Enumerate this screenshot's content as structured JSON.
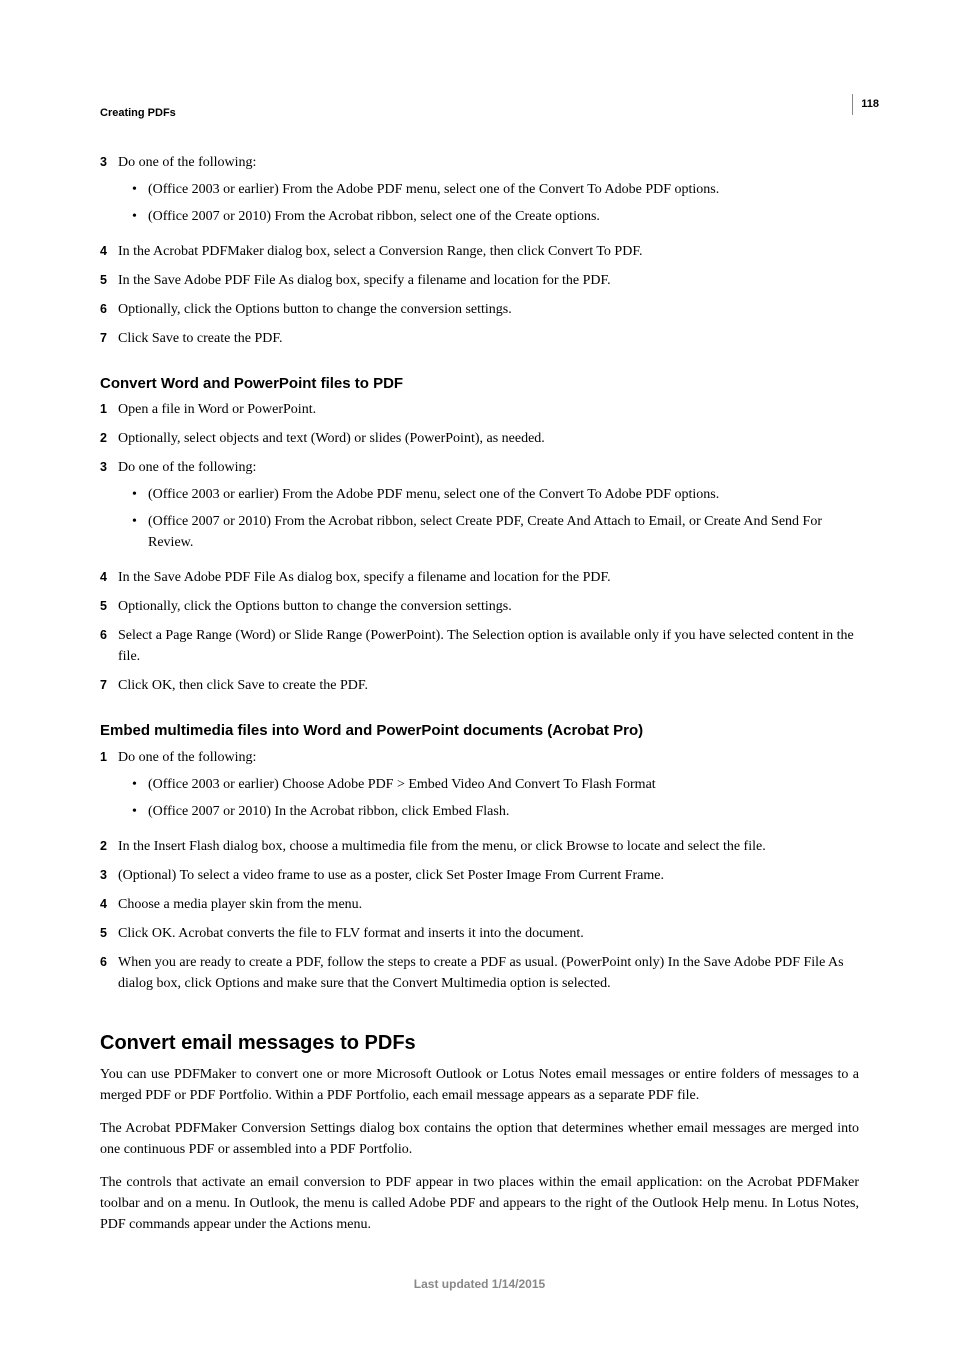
{
  "page_number": "118",
  "header": "Creating PDFs",
  "s1": {
    "i3": {
      "n": "3",
      "t": "Do one of the following:"
    },
    "i3a": "(Office 2003 or earlier) From the Adobe PDF menu, select one of the Convert To Adobe PDF options.",
    "i3b": "(Office 2007 or 2010) From the Acrobat ribbon, select one of the Create options.",
    "i4": {
      "n": "4",
      "t": "In the Acrobat PDFMaker dialog box, select a Conversion Range, then click Convert To PDF."
    },
    "i5": {
      "n": "5",
      "t": "In the Save Adobe PDF File As dialog box, specify a filename and location for the PDF."
    },
    "i6": {
      "n": "6",
      "t": "Optionally, click the Options button to change the conversion settings."
    },
    "i7": {
      "n": "7",
      "t": "Click Save to create the PDF."
    }
  },
  "h2a": "Convert Word and PowerPoint files to PDF",
  "s2": {
    "i1": {
      "n": "1",
      "t": "Open a file in Word or PowerPoint."
    },
    "i2": {
      "n": "2",
      "t": "Optionally, select objects and text (Word) or slides (PowerPoint), as needed."
    },
    "i3": {
      "n": "3",
      "t": "Do one of the following:"
    },
    "i3a": "(Office 2003 or earlier) From the Adobe PDF menu, select one of the Convert To Adobe PDF options.",
    "i3b": "(Office 2007 or 2010) From the Acrobat ribbon, select Create PDF, Create And Attach to Email, or Create And Send For Review.",
    "i4": {
      "n": "4",
      "t": "In the Save Adobe PDF File As dialog box, specify a filename and location for the PDF."
    },
    "i5": {
      "n": "5",
      "t": "Optionally, click the Options button to change the conversion settings."
    },
    "i6": {
      "n": "6",
      "t": "Select a Page Range (Word) or Slide Range (PowerPoint). The Selection option is available only if you have selected content in the file."
    },
    "i7": {
      "n": "7",
      "t": "Click OK, then click Save to create the PDF."
    }
  },
  "h2b": "Embed multimedia files into Word and PowerPoint documents (Acrobat Pro)",
  "s3": {
    "i1": {
      "n": "1",
      "t": "Do one of the following:"
    },
    "i1a": "(Office 2003 or earlier) Choose Adobe PDF > Embed Video And Convert To Flash Format",
    "i1b": "(Office 2007 or 2010) In the Acrobat ribbon, click Embed Flash.",
    "i2": {
      "n": "2",
      "t": "In the Insert Flash dialog box, choose a multimedia file from the menu, or click Browse to locate and select the file."
    },
    "i3": {
      "n": "3",
      "t": "(Optional) To select a video frame to use as a poster, click Set Poster Image From Current Frame."
    },
    "i4": {
      "n": "4",
      "t": "Choose a media player skin from the menu."
    },
    "i5": {
      "n": "5",
      "t": "Click OK. Acrobat converts the file to FLV format and inserts it into the document."
    },
    "i6": {
      "n": "6",
      "t": "When you are ready to create a PDF, follow the steps to create a PDF as usual. (PowerPoint only) In the Save Adobe PDF File As dialog box, click Options and make sure that the Convert Multimedia option is selected."
    }
  },
  "h1": "Convert email messages to PDFs",
  "p1": "You can use PDFMaker to convert one or more Microsoft Outlook or Lotus Notes email messages or entire folders of messages to a merged PDF or PDF Portfolio. Within a PDF Portfolio, each email message appears as a separate PDF file.",
  "p2": "The Acrobat PDFMaker Conversion Settings dialog box contains the option that determines whether email messages are merged into one continuous PDF or assembled into a PDF Portfolio.",
  "p3": "The controls that activate an email conversion to PDF appear in two places within the email application: on the Acrobat PDFMaker toolbar and on a menu. In Outlook, the menu is called Adobe PDF and appears to the right of the Outlook Help menu. In Lotus Notes, PDF commands appear under the Actions menu.",
  "footer": "Last updated 1/14/2015"
}
